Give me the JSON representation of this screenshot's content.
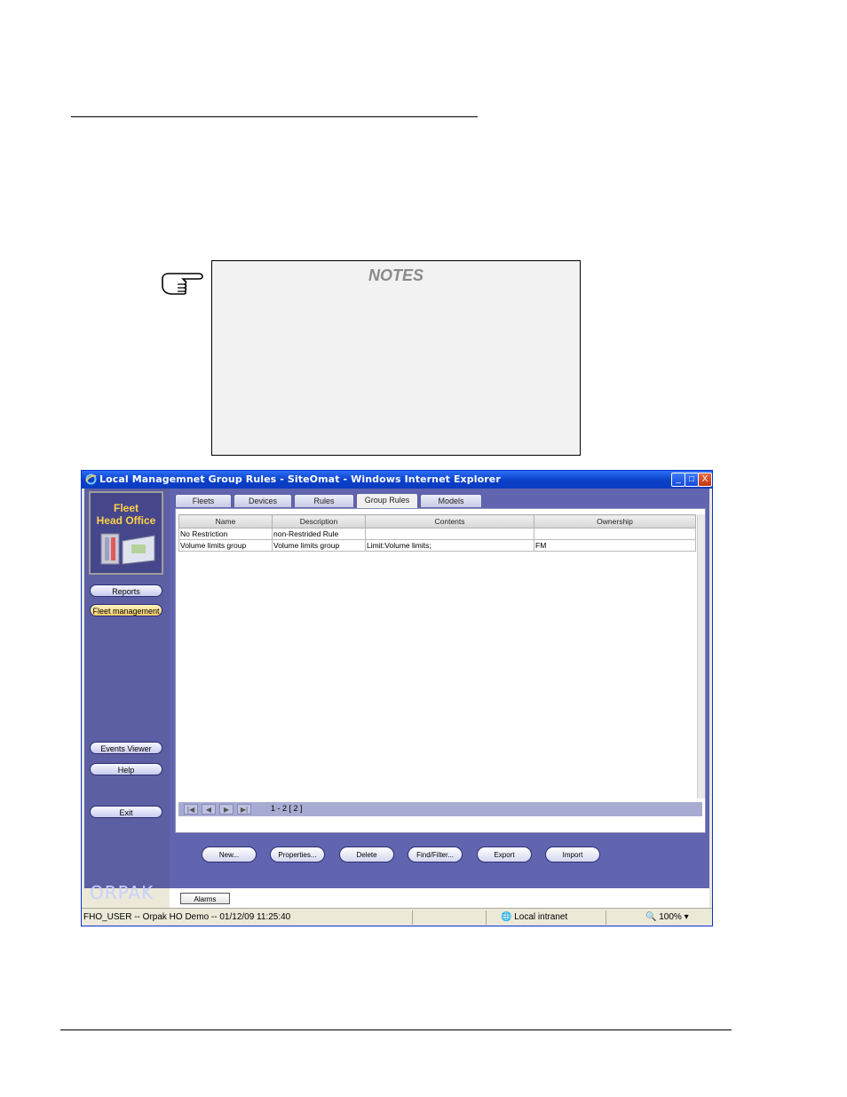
{
  "notes": {
    "title": "NOTES"
  },
  "window": {
    "title": "Local Managemnet Group Rules - SiteOmat - Windows Internet Explorer",
    "controls": {
      "minimize": "_",
      "maximize": "□",
      "close": "X"
    }
  },
  "sidebar": {
    "logo_line1": "Fleet",
    "logo_line2": "Head Office",
    "reports": "Reports",
    "fleet_management": "Fleet management",
    "events_viewer": "Events Viewer",
    "help": "Help",
    "exit": "Exit",
    "brand": "ORPAK"
  },
  "tabs": [
    "Fleets",
    "Devices",
    "Rules",
    "Group Rules",
    "Models"
  ],
  "active_tab": "Group Rules",
  "table": {
    "headers": [
      "Name",
      "Description",
      "Contents",
      "Ownership"
    ],
    "rows": [
      [
        "No Restriction",
        "non-Restrided Rule",
        "",
        ""
      ],
      [
        "Volume limits group",
        "Volume limits group",
        "Limit:Volume limits;",
        "FM"
      ]
    ]
  },
  "pager": {
    "first": "|◀",
    "prev": "◀",
    "next": "▶",
    "last": "▶|",
    "info": "1 - 2  [ 2 ]"
  },
  "actions": [
    "New...",
    "Properties...",
    "Delete",
    "Find/Filter...",
    "Export",
    "Import"
  ],
  "alarms": "Alarms",
  "status": {
    "user": "FHO_USER -- Orpak HO Demo -- 01/12/09   11:25:40",
    "zone": "Local intranet",
    "zoom": "100%"
  },
  "colors": {
    "title_bar": "#0a3fc9",
    "sidebar": "#5c5fa3",
    "main": "#6165b0",
    "logo_text": "#ffd04a"
  }
}
